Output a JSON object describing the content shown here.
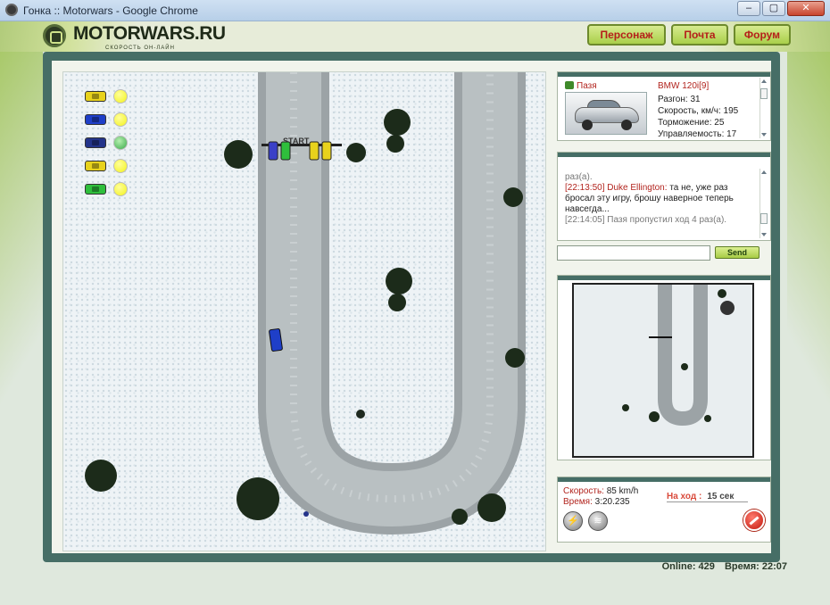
{
  "window": {
    "title": "Гонка :: Motorwars - Google Chrome",
    "buttons": [
      "–",
      "▢",
      "✕"
    ]
  },
  "site": {
    "logo": "MOTORWARS.RU",
    "tagline": "СКОРОСТЬ ОН-ЛАЙН"
  },
  "nav": [
    {
      "label": "Персонаж"
    },
    {
      "label": "Почта"
    },
    {
      "label": "Форум"
    }
  ],
  "board": {
    "players": [
      {
        "car_color": "#e8d21c",
        "status_color": "#f3f21a"
      },
      {
        "car_color": "#1f3fc8",
        "status_color": "#f3f21a"
      },
      {
        "car_color": "#24348a",
        "status_color": "#3aaa4a"
      },
      {
        "car_color": "#e8d21c",
        "status_color": "#f3f21a"
      },
      {
        "car_color": "#2fbf3c",
        "status_color": "#f3f21a"
      }
    ],
    "start_label": "START"
  },
  "car_info": {
    "driver": "Пазя",
    "model": "BMW 120i[9]",
    "stats": [
      "Разгон: 31",
      "Скорость, км/ч: 195",
      "Торможение: 25",
      "Управляемость: 17"
    ]
  },
  "chat": {
    "lines": [
      {
        "time": "",
        "who": "",
        "text": "раз(а)."
      },
      {
        "time": "[22:13:50]",
        "who": "Duke Ellington:",
        "text": "та не, уже раз бросал эту игру, брошу наверное теперь навсегда..."
      },
      {
        "time": "[22:14:05]",
        "who": "",
        "text": "Пазя пропустил ход 4 раз(а)."
      }
    ],
    "input_value": "",
    "send_label": "Send"
  },
  "status": {
    "speed_label": "Скорость:",
    "speed_value": "85 km/h",
    "time_label": "Время:",
    "time_value": "3:20.235",
    "turn_label": "На ход :",
    "turn_value": "15 сек"
  },
  "footer": {
    "online": "Online: 429",
    "clock": "Время: 22:07"
  },
  "colors": {
    "frame": "#466e66",
    "accent_red": "#b2241e",
    "nav_green": "#a9cf4a"
  }
}
